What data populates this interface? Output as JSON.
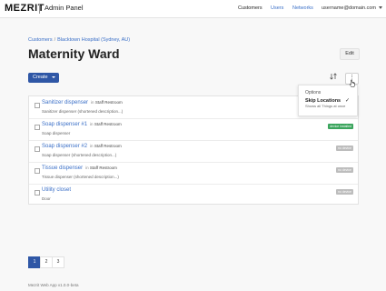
{
  "header": {
    "logo": "MEZRIT",
    "app_title": "Admin Panel",
    "nav": {
      "customers": "Customers",
      "users": "Users",
      "networks": "Networks",
      "user_email": "username@domain.com"
    }
  },
  "breadcrumb": {
    "root": "Customers",
    "separator": "/",
    "current": "Blacktown Hospital (Sydney, AU)"
  },
  "page": {
    "title": "Maternity Ward",
    "edit_label": "Edit",
    "create_label": "Create",
    "sort_icon": "sort-icon",
    "more_icon": "vertical-ellipsis-icon"
  },
  "dropdown": {
    "header": "Options",
    "item_label": "Skip Locations",
    "item_desc": "Shows all Things at once"
  },
  "things": [
    {
      "name": "Sanitizer dispenser",
      "in": "in",
      "location": "Staff Restroom",
      "desc": "Sanitizer dispenser (shortened description...)",
      "badge": ""
    },
    {
      "name": "Soap dispenser #1",
      "in": "in",
      "location": "Staff Restroom",
      "desc": "Soap dispenser",
      "badge": "device installed"
    },
    {
      "name": "Soap dispenser #2",
      "in": "in",
      "location": "Staff Restroom",
      "desc": "Soap dispenser (shortened description...)",
      "badge": "no device"
    },
    {
      "name": "Tissue dispenser",
      "in": "in",
      "location": "Staff Restroom",
      "desc": "Tissue dispenser (shortened description...)",
      "badge": "no device"
    },
    {
      "name": "Utility closet",
      "in": "",
      "location": "",
      "desc": "Door",
      "badge": "no device"
    }
  ],
  "pagination": {
    "pages": [
      "1",
      "2",
      "3"
    ],
    "active": "1"
  },
  "footer": {
    "text": "Mezrit Web App v1.0.0-beta"
  },
  "colors": {
    "accent": "#2f57a6",
    "link": "#3a6fc7",
    "badge_green": "#3ba55d",
    "badge_gray": "#bdbdbd"
  }
}
